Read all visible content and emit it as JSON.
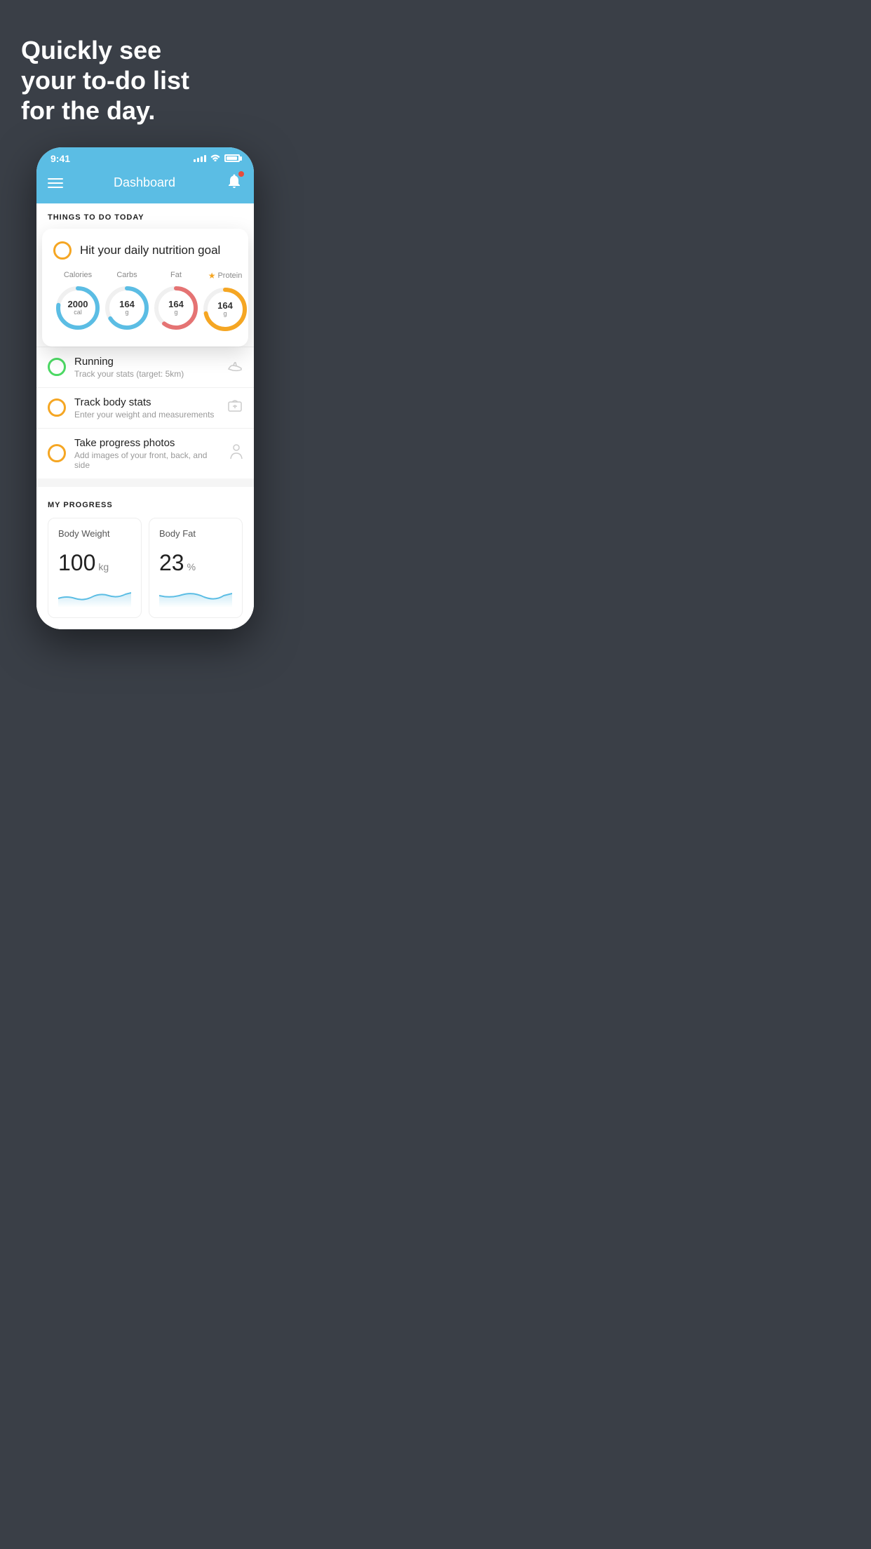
{
  "hero": {
    "title": "Quickly see\nyour to-do list\nfor the day."
  },
  "statusBar": {
    "time": "9:41",
    "signalBars": [
      3,
      5,
      7,
      9,
      11
    ],
    "batteryPercent": 75
  },
  "header": {
    "title": "Dashboard",
    "menuLabel": "Menu",
    "bellLabel": "Notifications"
  },
  "thingsSection": {
    "title": "THINGS TO DO TODAY"
  },
  "nutritionCard": {
    "title": "Hit your daily nutrition goal",
    "items": [
      {
        "label": "Calories",
        "value": "2000",
        "unit": "cal",
        "type": "calories",
        "dashoffset": 30,
        "starred": false
      },
      {
        "label": "Carbs",
        "value": "164",
        "unit": "g",
        "type": "carbs",
        "dashoffset": 50,
        "starred": false
      },
      {
        "label": "Fat",
        "value": "164",
        "unit": "g",
        "type": "fat",
        "dashoffset": 60,
        "starred": false
      },
      {
        "label": "Protein",
        "value": "164",
        "unit": "g",
        "type": "protein",
        "dashoffset": 40,
        "starred": true
      }
    ]
  },
  "todoItems": [
    {
      "id": "running",
      "title": "Running",
      "subtitle": "Track your stats (target: 5km)",
      "checkColor": "green",
      "icon": "shoe"
    },
    {
      "id": "body-stats",
      "title": "Track body stats",
      "subtitle": "Enter your weight and measurements",
      "checkColor": "yellow",
      "icon": "scale"
    },
    {
      "id": "progress-photos",
      "title": "Take progress photos",
      "subtitle": "Add images of your front, back, and side",
      "checkColor": "yellow",
      "icon": "person"
    }
  ],
  "progressSection": {
    "title": "MY PROGRESS",
    "cards": [
      {
        "label": "Body Weight",
        "value": "100",
        "unit": "kg"
      },
      {
        "label": "Body Fat",
        "value": "23",
        "unit": "%"
      }
    ]
  }
}
